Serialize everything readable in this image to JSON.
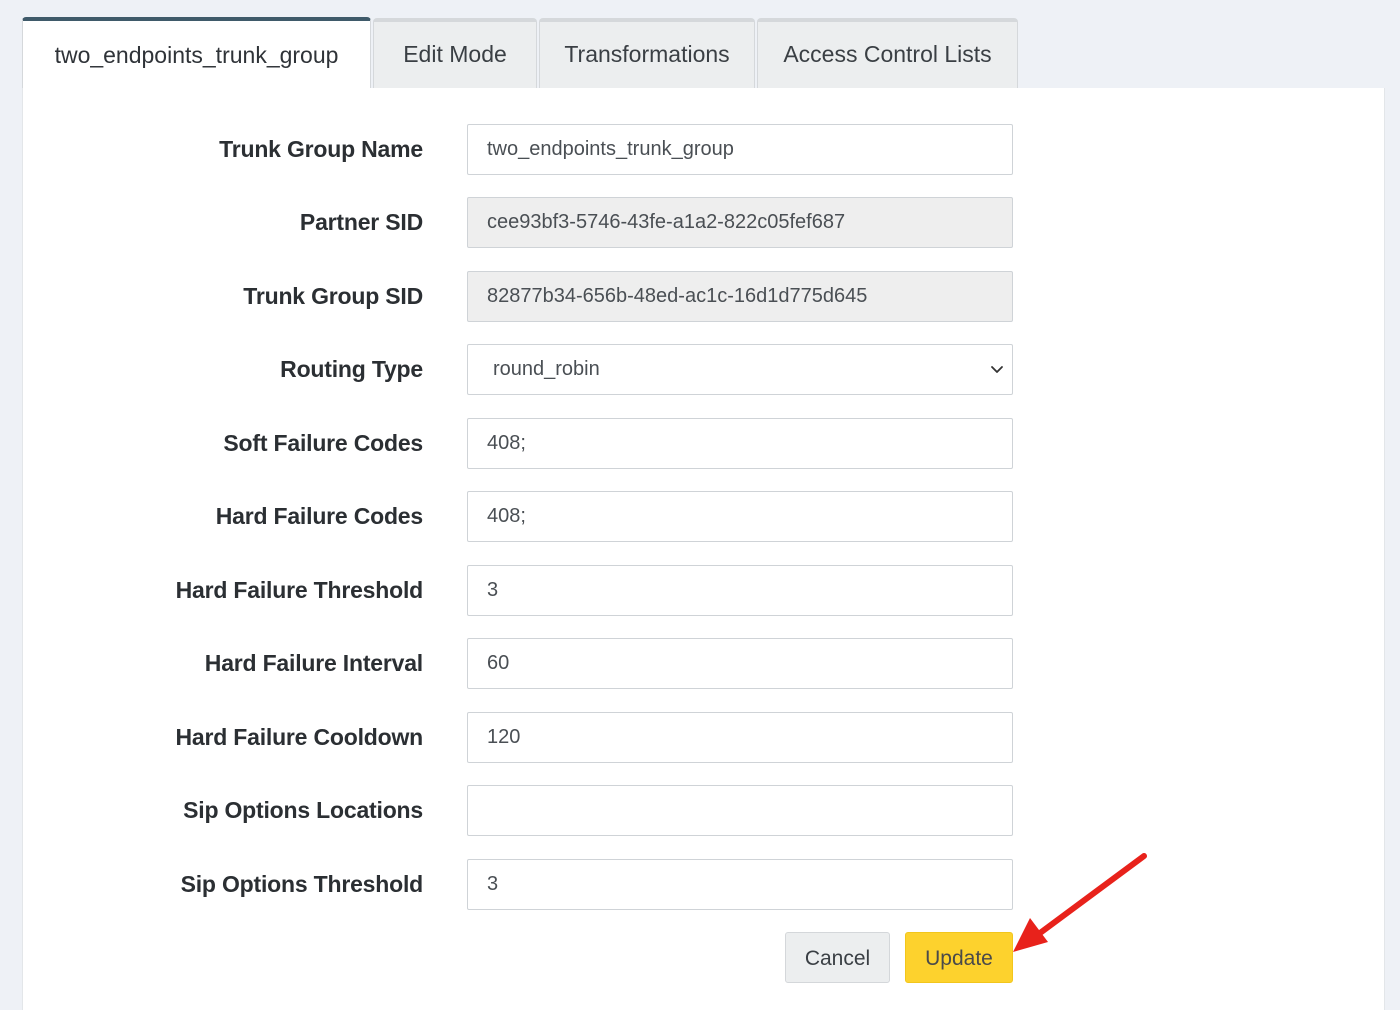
{
  "tabs": [
    {
      "label": "two_endpoints_trunk_group",
      "active": true
    },
    {
      "label": "Edit Mode",
      "active": false
    },
    {
      "label": "Transformations",
      "active": false
    },
    {
      "label": "Access Control Lists",
      "active": false
    }
  ],
  "form": {
    "trunk_group_name": {
      "label": "Trunk Group Name",
      "value": "two_endpoints_trunk_group"
    },
    "partner_sid": {
      "label": "Partner SID",
      "value": "cee93bf3-5746-43fe-a1a2-822c05fef687"
    },
    "trunk_group_sid": {
      "label": "Trunk Group SID",
      "value": "82877b34-656b-48ed-ac1c-16d1d775d645"
    },
    "routing_type": {
      "label": "Routing Type",
      "value": "round_robin"
    },
    "soft_failure_codes": {
      "label": "Soft Failure Codes",
      "value": "408;"
    },
    "hard_failure_codes": {
      "label": "Hard Failure Codes",
      "value": "408;"
    },
    "hard_failure_threshold": {
      "label": "Hard Failure Threshold",
      "value": "3"
    },
    "hard_failure_interval": {
      "label": "Hard Failure Interval",
      "value": "60"
    },
    "hard_failure_cooldown": {
      "label": "Hard Failure Cooldown",
      "value": "120"
    },
    "sip_options_locations": {
      "label": "Sip Options Locations",
      "value": ""
    },
    "sip_options_threshold": {
      "label": "Sip Options Threshold",
      "value": "3"
    }
  },
  "buttons": {
    "cancel_label": "Cancel",
    "update_label": "Update"
  },
  "colors": {
    "update_button": "#fdd22d",
    "active_tab_border": "#3f5a6a",
    "annotation_arrow": "#e8221b"
  },
  "icons": {
    "select_chevron": "chevron-down-icon",
    "annotation": "red-arrow-icon"
  }
}
